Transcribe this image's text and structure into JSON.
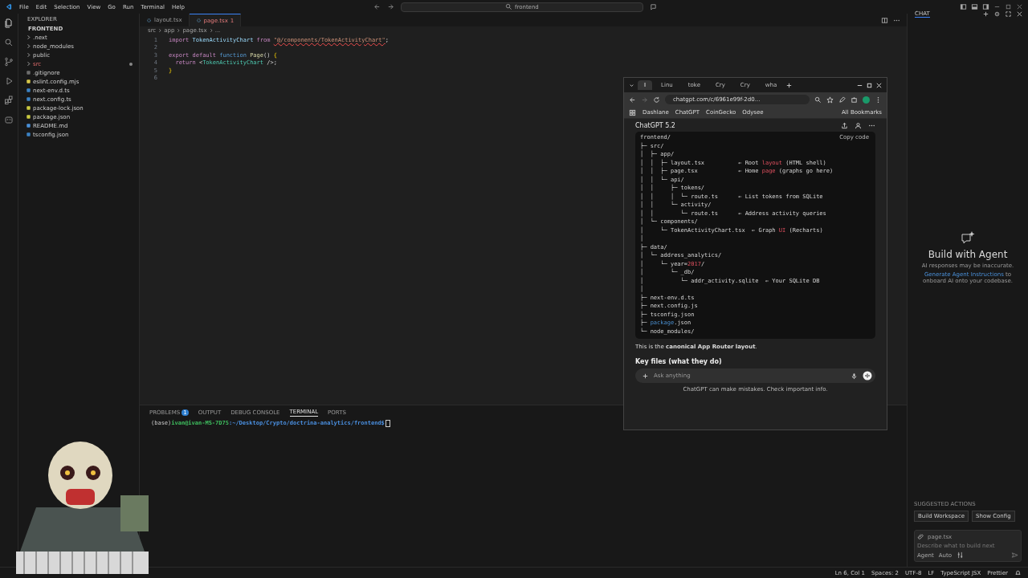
{
  "titlebar": {
    "menu": [
      "File",
      "Edit",
      "Selection",
      "View",
      "Go",
      "Run",
      "Terminal",
      "Help"
    ],
    "search": "frontend"
  },
  "explorer": {
    "title": "EXPLORER",
    "root": "FRONTEND",
    "items": [
      {
        "label": ".next",
        "kind": "folder",
        "modified": false
      },
      {
        "label": "node_modules",
        "kind": "folder",
        "modified": false
      },
      {
        "label": "public",
        "kind": "folder",
        "modified": false
      },
      {
        "label": "src",
        "kind": "folder",
        "modified": true
      },
      {
        "label": ".gitignore",
        "kind": "git",
        "modified": false
      },
      {
        "label": "eslint.config.mjs",
        "kind": "js",
        "modified": false
      },
      {
        "label": "next-env.d.ts",
        "kind": "ts",
        "modified": false
      },
      {
        "label": "next.config.ts",
        "kind": "ts",
        "modified": false
      },
      {
        "label": "package-lock.json",
        "kind": "json",
        "modified": false
      },
      {
        "label": "package.json",
        "kind": "json",
        "modified": false
      },
      {
        "label": "README.md",
        "kind": "info",
        "modified": false
      },
      {
        "label": "tsconfig.json",
        "kind": "tsconfig",
        "modified": false
      }
    ]
  },
  "editor": {
    "tabs": [
      {
        "label": "layout.tsx",
        "selected": false
      },
      {
        "label": "page.tsx",
        "badge": "1",
        "selected": true
      }
    ],
    "breadcrumb": [
      "src",
      "app",
      "page.tsx",
      "..."
    ],
    "lines": [
      {
        "number": "1",
        "tokens": [
          {
            "text": "import ",
            "kind": "keyword"
          },
          {
            "text": "TokenActivityChart ",
            "kind": "identifier"
          },
          {
            "text": "from ",
            "kind": "keyword"
          },
          {
            "text": "\"@/components/TokenActivityChart\"",
            "kind": "error"
          },
          {
            "text": ";",
            "kind": "punctuation"
          }
        ]
      },
      {
        "number": "2"
      },
      {
        "number": "3",
        "tokens": [
          {
            "text": "export default ",
            "kind": "keyword"
          },
          {
            "text": "function ",
            "kind": "storage"
          },
          {
            "text": "Page",
            "kind": "function"
          },
          {
            "text": "() ",
            "kind": "punctuation"
          },
          {
            "text": "{",
            "kind": "brace"
          }
        ]
      },
      {
        "number": "4",
        "tokens": [
          {
            "text": "  return ",
            "kind": "keyword"
          },
          {
            "text": "<",
            "kind": "punctuation"
          },
          {
            "text": "TokenActivityChart",
            "kind": "tag"
          },
          {
            "text": " />;",
            "kind": "punctuation"
          }
        ]
      },
      {
        "number": "5",
        "tokens": [
          {
            "text": "}",
            "kind": "brace"
          }
        ]
      },
      {
        "number": "6"
      }
    ]
  },
  "panel": {
    "tabs": [
      {
        "label": "PROBLEMS",
        "badge": "1",
        "selected": false
      },
      {
        "label": "OUTPUT",
        "selected": false
      },
      {
        "label": "DEBUG CONSOLE",
        "selected": false
      },
      {
        "label": "TERMINAL",
        "selected": true
      },
      {
        "label": "PORTS",
        "selected": false
      }
    ],
    "terminal": {
      "env": "(base)",
      "user": "ivan@ivan-MS-7D75",
      "path": ":~/Desktop/Crypto/doctrina-analytics/frontend$"
    }
  },
  "browser": {
    "tabs": [
      {
        "label": "I",
        "selected": true
      },
      {
        "label": "Linu",
        "selected": false
      },
      {
        "label": "toke",
        "selected": false
      },
      {
        "label": "Cry",
        "selected": false
      },
      {
        "label": "Cry",
        "selected": false
      },
      {
        "label": "wha",
        "selected": false
      }
    ],
    "url": "chatgpt.com/c/6961e99f-2d0...",
    "bookmarks": [
      "Dashlane",
      "ChatGPT",
      "CoinGecko",
      "Odysee"
    ],
    "all_bookmarks": "All Bookmarks",
    "model": "ChatGPT 5.2",
    "copy": "Copy code",
    "code": [
      [
        {
          "text": "frontend/",
          "kind": "plain"
        }
      ],
      [
        {
          "text": "├─ src/",
          "kind": "plain"
        }
      ],
      [
        {
          "text": "│  ├─ app/",
          "kind": "plain"
        }
      ],
      [
        {
          "text": "│  │  ├─ layout.tsx          ← Root ",
          "kind": "plain"
        },
        {
          "text": "layout",
          "kind": "highlight"
        },
        {
          "text": " (HTML shell)",
          "kind": "plain"
        }
      ],
      [
        {
          "text": "│  │  ├─ page.tsx            ← Home ",
          "kind": "plain"
        },
        {
          "text": "page",
          "kind": "highlight"
        },
        {
          "text": " (graphs go here)",
          "kind": "plain"
        }
      ],
      [
        {
          "text": "│  │  └─ api/",
          "kind": "plain"
        }
      ],
      [
        {
          "text": "│  │     ├─ tokens/",
          "kind": "plain"
        }
      ],
      [
        {
          "text": "│  │     │  └─ route.ts      ← List tokens from SQLite",
          "kind": "plain"
        }
      ],
      [
        {
          "text": "│  │     └─ activity/",
          "kind": "plain"
        }
      ],
      [
        {
          "text": "│  │        └─ route.ts      ← Address activity queries",
          "kind": "plain"
        }
      ],
      [
        {
          "text": "│  └─ components/",
          "kind": "plain"
        }
      ],
      [
        {
          "text": "│     └─ TokenActivityChart.tsx  ← Graph ",
          "kind": "plain"
        },
        {
          "text": "UI",
          "kind": "highlight"
        },
        {
          "text": " (Recharts)",
          "kind": "plain"
        }
      ],
      [
        {
          "text": "│",
          "kind": "plain"
        }
      ],
      [
        {
          "text": "├─ data/",
          "kind": "plain"
        }
      ],
      [
        {
          "text": "│  └─ address_analytics/",
          "kind": "plain"
        }
      ],
      [
        {
          "text": "│     └─ year=",
          "kind": "plain"
        },
        {
          "text": "2017",
          "kind": "highlight"
        },
        {
          "text": "/",
          "kind": "plain"
        }
      ],
      [
        {
          "text": "│        └─ _db/",
          "kind": "plain"
        }
      ],
      [
        {
          "text": "│           └─ addr_activity.sqlite  ← Your SQLite DB",
          "kind": "plain"
        }
      ],
      [
        {
          "text": "│",
          "kind": "plain"
        }
      ],
      [
        {
          "text": "├─ next-env.d.ts",
          "kind": "plain"
        }
      ],
      [
        {
          "text": "├─ next.config.js",
          "kind": "plain"
        }
      ],
      [
        {
          "text": "├─ tsconfig.json",
          "kind": "plain"
        }
      ],
      [
        {
          "text": "├─ ",
          "kind": "plain"
        },
        {
          "text": "package",
          "kind": "link"
        },
        {
          "text": ".json",
          "kind": "plain"
        }
      ],
      [
        {
          "text": "└─ node_modules/",
          "kind": "plain"
        }
      ]
    ],
    "message": "This is the **canonical App Router layout**.",
    "heading": "Key files (what they do)",
    "placeholder": "Ask anything",
    "disclaimer": "ChatGPT can make mistakes. Check important info."
  },
  "chat": {
    "tab": "CHAT",
    "title": "Build with Agent",
    "note": "AI responses may be inaccurate.",
    "link": "Generate Agent Instructions",
    "link_rest": "to onboard AI onto your codebase.",
    "suggested_title": "SUGGESTED ACTIONS",
    "actions": [
      "Build Workspace",
      "Show Config"
    ],
    "attachment": "page.tsx",
    "placeholder": "Describe what to build next",
    "mode": "Agent",
    "model": "Auto"
  },
  "status_bar": [
    "Ln 6, Col 1",
    "Spaces: 2",
    "UTF-8",
    "LF",
    "TypeScript JSX",
    "Prettier"
  ]
}
